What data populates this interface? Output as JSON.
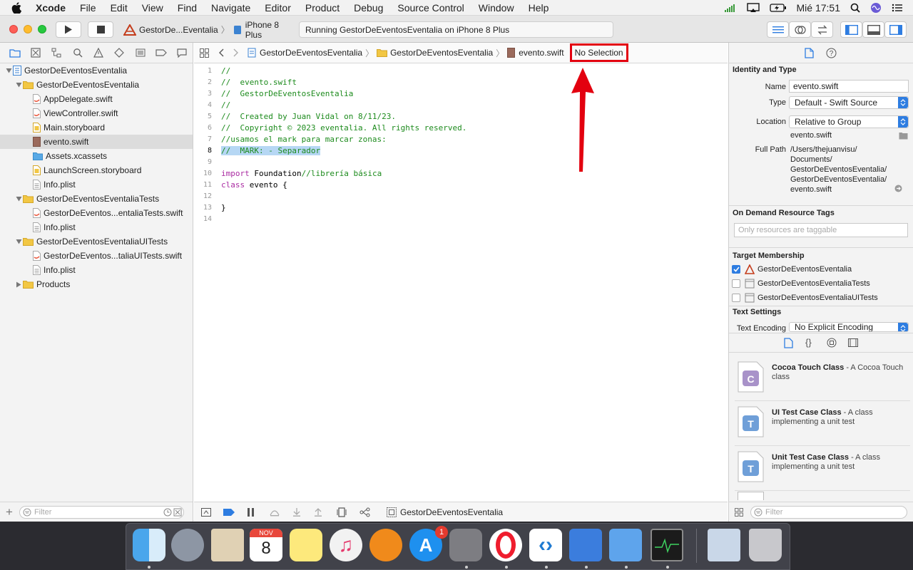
{
  "menubar": {
    "app_name": "Xcode",
    "items": [
      "File",
      "Edit",
      "View",
      "Find",
      "Navigate",
      "Editor",
      "Product",
      "Debug",
      "Source Control",
      "Window",
      "Help"
    ],
    "clock": "Mié 17:51"
  },
  "toolbar": {
    "scheme_name": "GestorDe...Eventalia",
    "device": "iPhone 8 Plus",
    "status": "Running GestorDeEventosEventalia on iPhone 8 Plus"
  },
  "navigator": {
    "items": [
      {
        "label": "GestorDeEventosEventalia"
      },
      {
        "label": "GestorDeEventosEventalia"
      },
      {
        "label": "AppDelegate.swift"
      },
      {
        "label": "ViewController.swift"
      },
      {
        "label": "Main.storyboard"
      },
      {
        "label": "evento.swift"
      },
      {
        "label": "Assets.xcassets"
      },
      {
        "label": "LaunchScreen.storyboard"
      },
      {
        "label": "Info.plist"
      },
      {
        "label": "GestorDeEventosEventaliaTests"
      },
      {
        "label": "GestorDeEventos...entaliaTests.swift"
      },
      {
        "label": "Info.plist"
      },
      {
        "label": "GestorDeEventosEventaliaUITests"
      },
      {
        "label": "GestorDeEventos...taliaUITests.swift"
      },
      {
        "label": "Info.plist"
      },
      {
        "label": "Products"
      }
    ],
    "filter_placeholder": "Filter"
  },
  "editor": {
    "breadcrumb": [
      "GestorDeEventosEventalia",
      "GestorDeEventosEventalia",
      "evento.swift",
      "No Selection"
    ],
    "lines": [
      {
        "num": "1",
        "text": "//"
      },
      {
        "num": "2",
        "text": "//  evento.swift"
      },
      {
        "num": "3",
        "text": "//  GestorDeEventosEventalia"
      },
      {
        "num": "4",
        "text": "//"
      },
      {
        "num": "5",
        "text": "//  Created by Juan Vidal on 8/11/23."
      },
      {
        "num": "6",
        "text": "//  Copyright © 2023 eventalia. All rights reserved."
      },
      {
        "num": "7",
        "text": "//usamos el mark para marcar zonas:"
      },
      {
        "num": "8",
        "text": "//  MARK: - Separador"
      },
      {
        "num": "9",
        "text": ""
      },
      {
        "num": "10",
        "kw": "import",
        "rest": " Foundation",
        "cmt": "//librería básica"
      },
      {
        "num": "11",
        "kw": "class",
        "rest": " evento {"
      },
      {
        "num": "12",
        "text": ""
      },
      {
        "num": "13",
        "text": "}"
      },
      {
        "num": "14",
        "text": ""
      }
    ],
    "debug_target": "GestorDeEventosEventalia"
  },
  "inspector": {
    "identity_header": "Identity and Type",
    "name_label": "Name",
    "name_value": "evento.swift",
    "type_label": "Type",
    "type_value": "Default - Swift Source",
    "location_label": "Location",
    "location_value": "Relative to Group",
    "location_file": "evento.swift",
    "fullpath_label": "Full Path",
    "fullpath_lines": [
      "/Users/thejuanvisu/",
      "Documents/",
      "GestorDeEventosEventalia/",
      "GestorDeEventosEventalia/",
      "evento.swift"
    ],
    "odr_header": "On Demand Resource Tags",
    "odr_placeholder": "Only resources are taggable",
    "target_header": "Target Membership",
    "targets": [
      {
        "label": "GestorDeEventosEventalia",
        "checked": true
      },
      {
        "label": "GestorDeEventosEventaliaTests",
        "checked": false
      },
      {
        "label": "GestorDeEventosEventaliaUITests",
        "checked": false
      }
    ],
    "text_settings_header": "Text Settings",
    "encoding_label": "Text Encoding",
    "encoding_value": "No Explicit Encoding",
    "library": [
      {
        "letter": "C",
        "name": "Cocoa Touch Class",
        "desc": " - A Cocoa Touch class",
        "color": "#a892c9"
      },
      {
        "letter": "T",
        "name": "UI Test Case Class",
        "desc": " - A class implementing a unit test",
        "color": "#6f9fd8"
      },
      {
        "letter": "T",
        "name": "Unit Test Case Class",
        "desc": " - A class implementing a unit test",
        "color": "#6f9fd8"
      }
    ],
    "filter_placeholder": "Filter"
  },
  "dock": {
    "calendar_month": "NOV",
    "calendar_day": "8",
    "appstore_badge": "1"
  },
  "colors": {
    "accent": "#2e7de1",
    "annotation_red": "#e3000f",
    "comment_green": "#1d8b1d",
    "keyword_purple": "#aa2ba2"
  }
}
